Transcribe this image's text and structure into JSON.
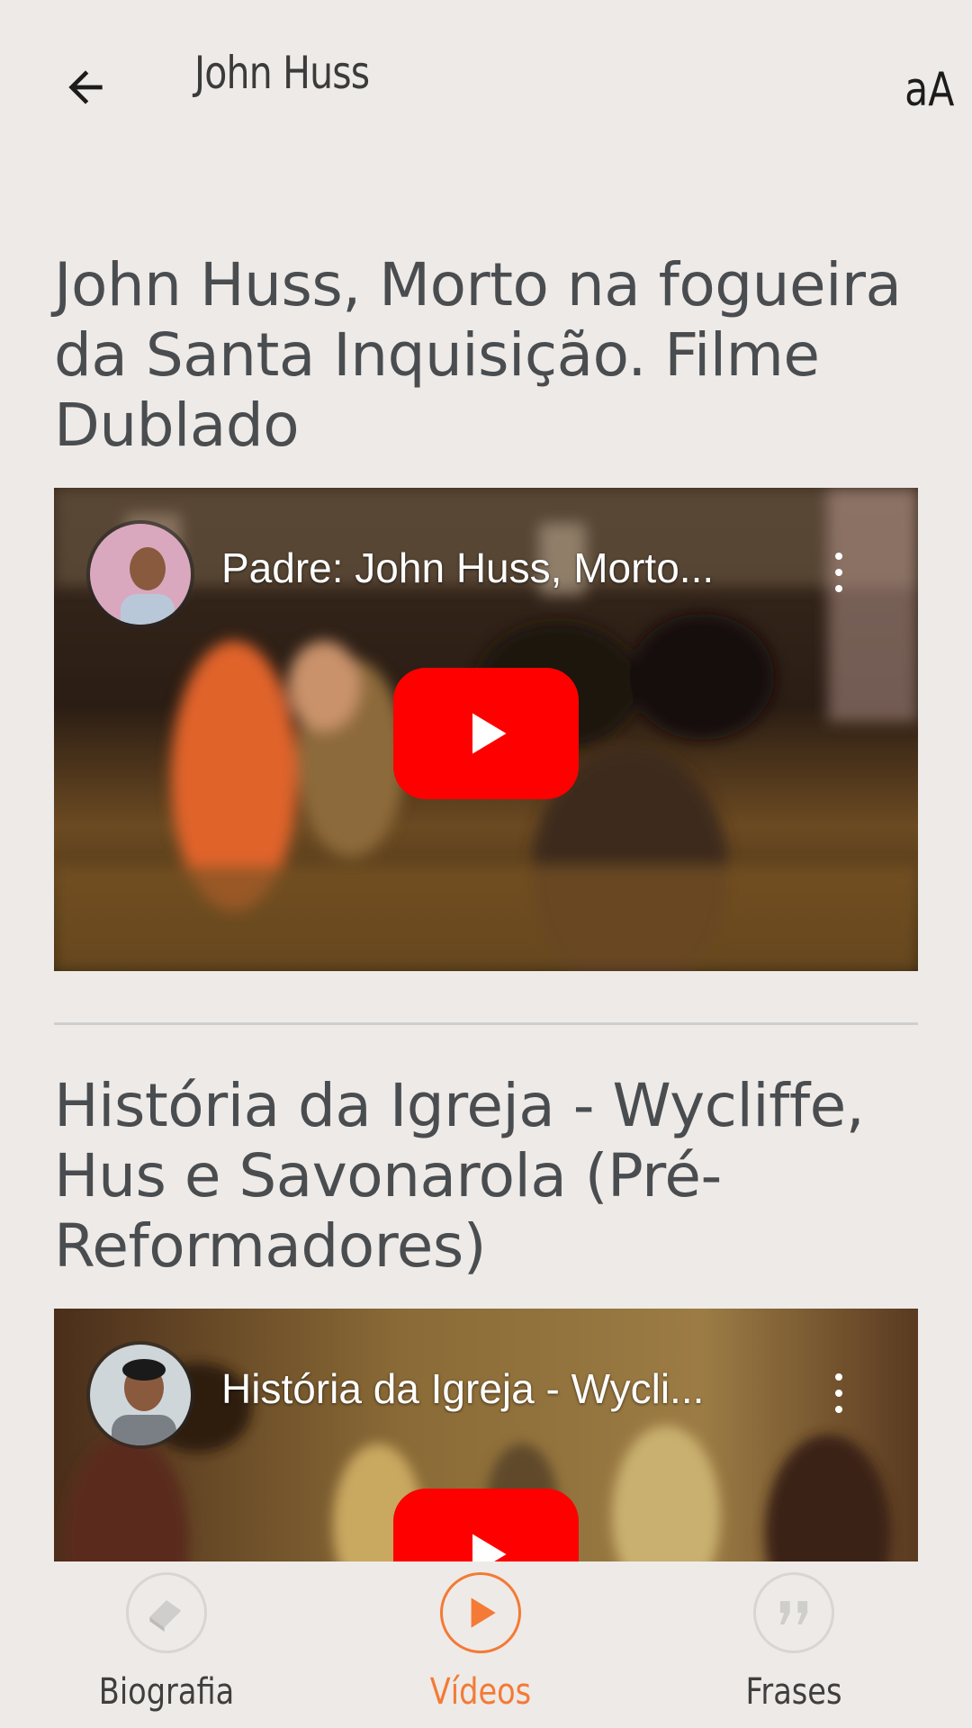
{
  "header": {
    "title": "John Huss",
    "font_size_label": "aA"
  },
  "videos": [
    {
      "title": "John Huss, Morto na fogueira da Santa Inquisição. Filme Dublado",
      "player_title": "Padre: John Huss, Morto...",
      "thumbnail": "stage-scene-orange"
    },
    {
      "title": "História da Igreja - Wycliffe, Hus e Savonarola (Pré-Reformadores)",
      "player_title": "História da Igreja - Wycli...",
      "thumbnail": "painting-scene-gold"
    }
  ],
  "bottom_nav": {
    "items": [
      {
        "label": "Biografia",
        "icon": "book-icon",
        "active": false
      },
      {
        "label": "Vídeos",
        "icon": "play-icon",
        "active": true
      },
      {
        "label": "Frases",
        "icon": "quote-icon",
        "active": false
      }
    ]
  },
  "colors": {
    "background": "#eeeae7",
    "accent": "#f47a36",
    "youtube_red": "#ff0000",
    "title_text": "#4a4d50"
  }
}
